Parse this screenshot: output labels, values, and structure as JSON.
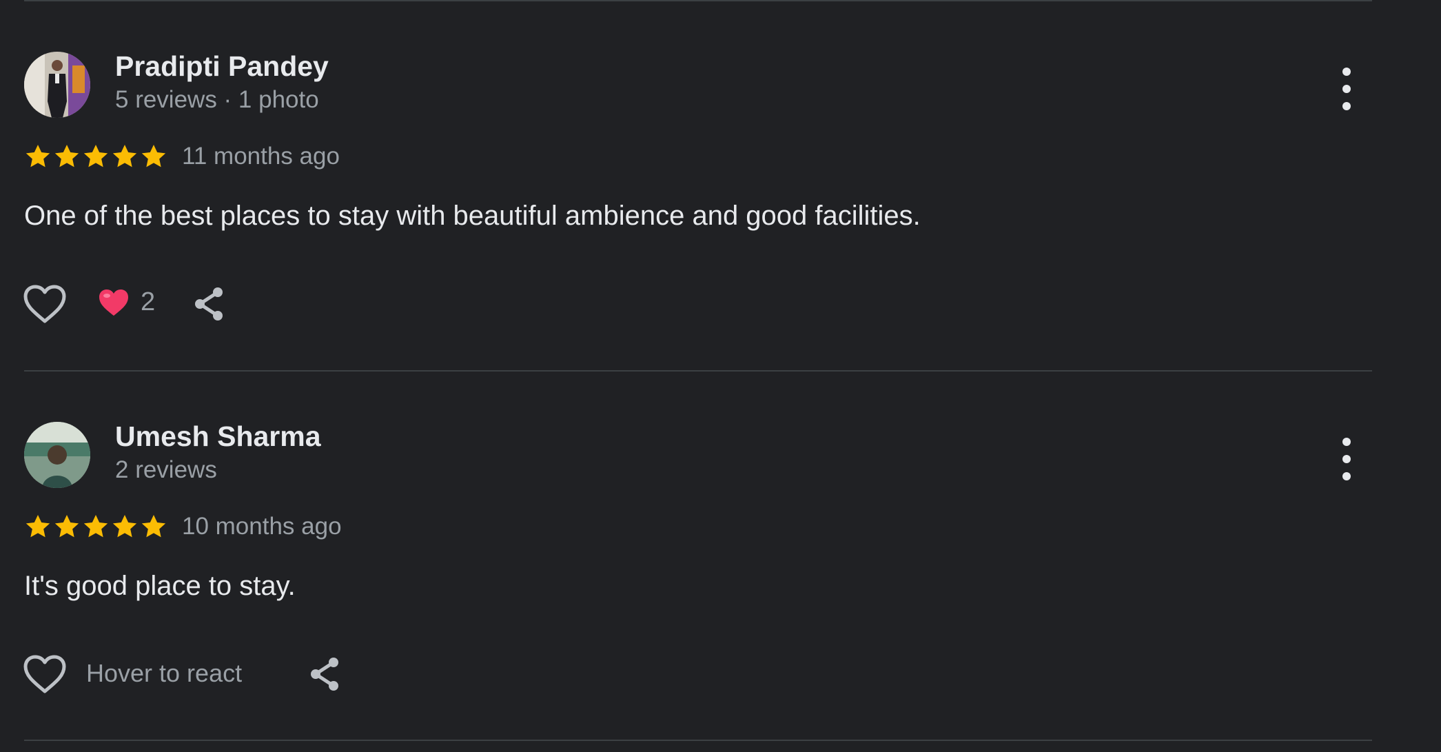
{
  "colors": {
    "background": "#202124",
    "divider": "#3c4043",
    "star": "#fbbc04",
    "heart": "#f23a67",
    "primary_text": "#e8eaed",
    "secondary_text": "#9aa0a6"
  },
  "reviews": [
    {
      "name": "Pradipti Pandey",
      "meta": "5 reviews · 1 photo",
      "rating": 5,
      "time": "11 months ago",
      "text": "One of the best places to stay with beautiful ambience and good facilities.",
      "reaction_count": "2",
      "icons": {
        "like": "heart-outline-icon",
        "reaction": "red-heart-icon",
        "share": "share-icon",
        "more": "more-vert-icon"
      }
    },
    {
      "name": "Umesh Sharma",
      "meta": "2 reviews",
      "rating": 5,
      "time": "10 months ago",
      "text": "It's good place to stay.",
      "hover_label": "Hover to react",
      "icons": {
        "like": "heart-outline-icon",
        "share": "share-icon",
        "more": "more-vert-icon"
      }
    }
  ]
}
